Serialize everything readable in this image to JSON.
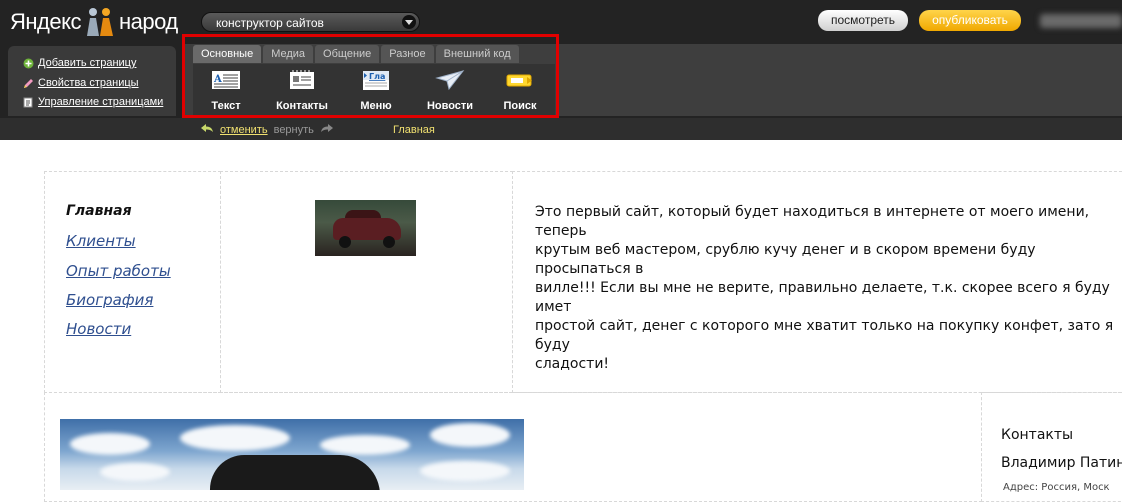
{
  "header": {
    "logo_yandex": "Яндекс",
    "logo_narod": "народ",
    "builder_select": "конструктор сайтов",
    "preview_label": "посмотреть",
    "publish_label": "опубликовать"
  },
  "page_panel": {
    "add_page": "Добавить страницу",
    "page_props": "Свойства страницы",
    "manage_pages": "Управление страницами"
  },
  "tabs": [
    "Основные",
    "Медиа",
    "Общение",
    "Разное",
    "Внешний код"
  ],
  "tools": [
    {
      "label": "Текст",
      "icon": "text-block-icon"
    },
    {
      "label": "Контакты",
      "icon": "contacts-card-icon"
    },
    {
      "label": "Меню",
      "icon": "menu-icon",
      "icon_text": "Гла"
    },
    {
      "label": "Новости",
      "icon": "paper-plane-icon"
    },
    {
      "label": "Поиск",
      "icon": "search-box-icon"
    }
  ],
  "history": {
    "undo": "отменить",
    "redo": "вернуть",
    "breadcrumb": "Главная"
  },
  "site_nav": [
    "Главная",
    "Клиенты",
    "Опыт работы",
    "Биография",
    "Новости"
  ],
  "site_nav_current": "Главная",
  "main_text": "Это первый сайт, который будет находиться в интернете от моего имени, теперь\nкрутым веб мастером, срублю кучу денег и в скором времени буду просыпаться в\nвилле!!! Если вы мне не верите, правильно делаете, т.к. скорее всего я буду имет\nпростой сайт, денег с которого мне хватит только на покупку конфет, зато я буду\nсладости!",
  "contacts": {
    "title": "Контакты",
    "name": "Владимир Патин",
    "address": "Адрес: Россия, Моск"
  },
  "colors": {
    "toolbar_bg": "#232323",
    "highlight": "#e10000",
    "accent_yellow": "#f0e070",
    "publish": "#f0a800",
    "link_blue": "#2f4f8f"
  }
}
